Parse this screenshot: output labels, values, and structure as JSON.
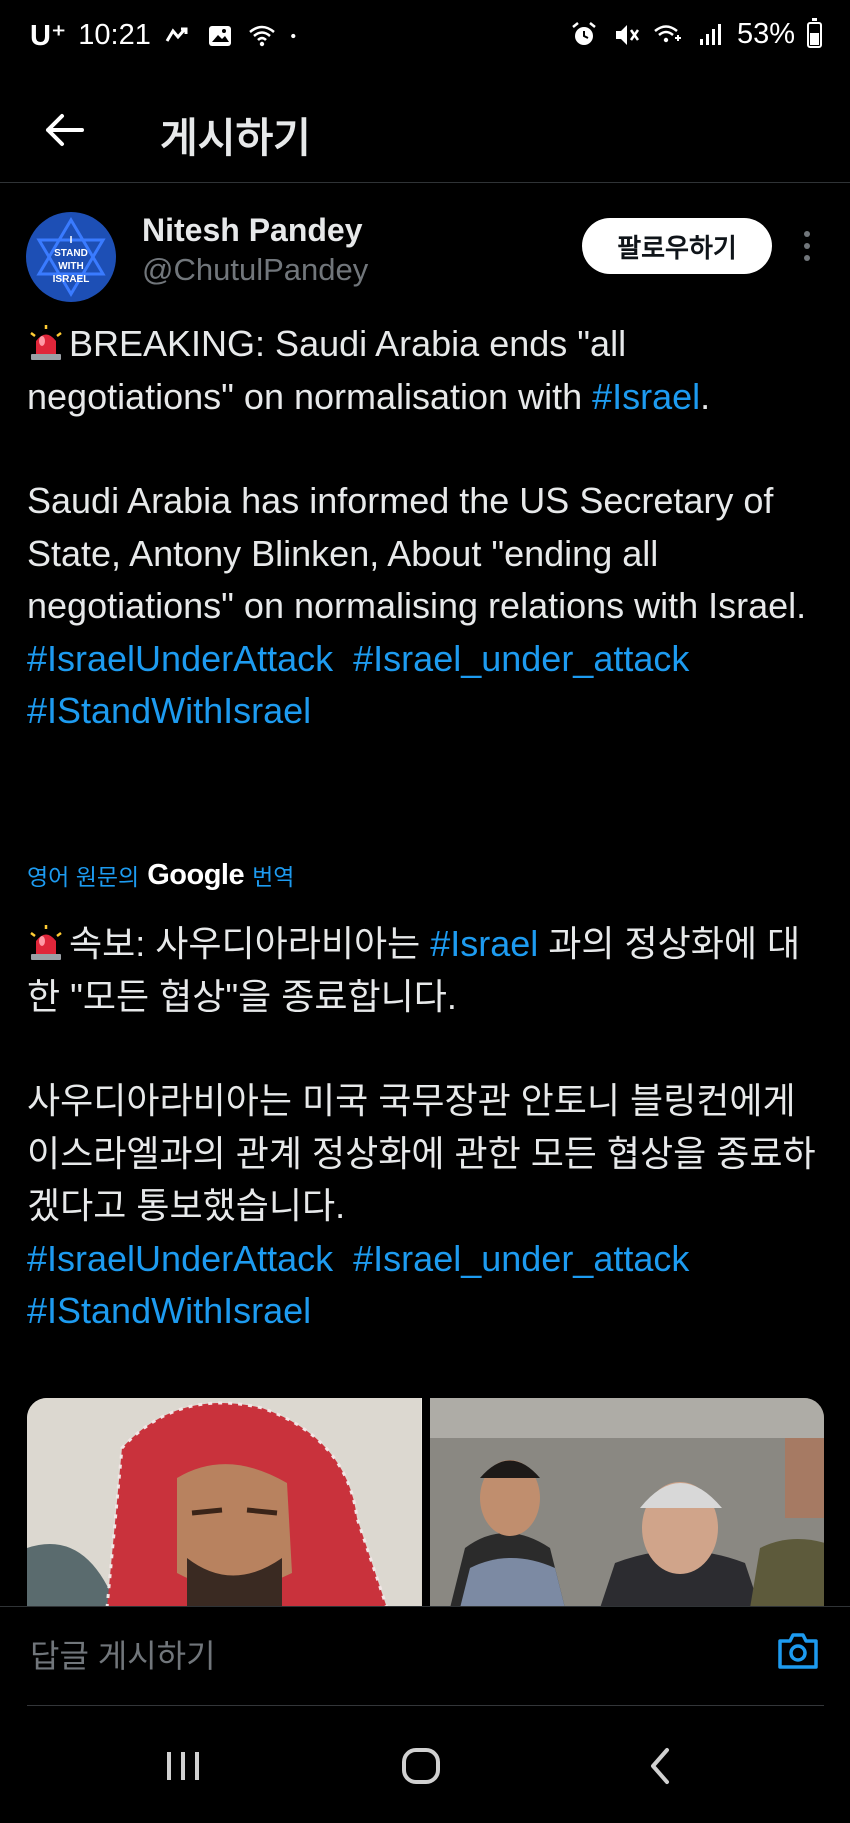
{
  "status": {
    "carrier": "U⁺",
    "time": "10:21",
    "battery": "53%",
    "battery_level": 0.53
  },
  "header": {
    "title": "게시하기"
  },
  "author": {
    "avatar_lines": [
      "I",
      "STAND",
      "WITH",
      "ISRAEL"
    ],
    "name": "Nitesh Pandey",
    "handle": "@ChutulPandey",
    "follow_label": "팔로우하기"
  },
  "post": {
    "p1_text": "BREAKING: Saudi Arabia ends \"all negotiations\" on normalisation with ",
    "p1_tag": "#Israel",
    "p1_end": ".",
    "p2_text": "Saudi Arabia has informed the US Secretary of State, Antony Blinken, About \"ending all negotiations\" on normalising relations with Israel.",
    "tags": [
      "#IsraelUnderAttack",
      "#Israel_under_attack",
      "#IStandWithIsrael"
    ]
  },
  "translation": {
    "prefix": "영어 원문의",
    "google": "Google",
    "suffix": "번역",
    "p1_a": "속보: 사우디아라비아는 ",
    "p1_tag": "#Israel",
    "p1_b": " 과의 정상화에 대한 \"모든 협상\"을 종료합니다.",
    "p2_text": "사우디아라비아는 미국 국무장관 안토니 블링컨에게 이스라엘과의 관계 정상화에 관한 모든 협상을 종료하겠다고 통보했습니다."
  },
  "reply": {
    "placeholder": "답글 게시하기"
  },
  "colors": {
    "background": "#000000",
    "accent": "#1d9bf0",
    "text": "#e7e9ea",
    "muted": "#71767b"
  }
}
